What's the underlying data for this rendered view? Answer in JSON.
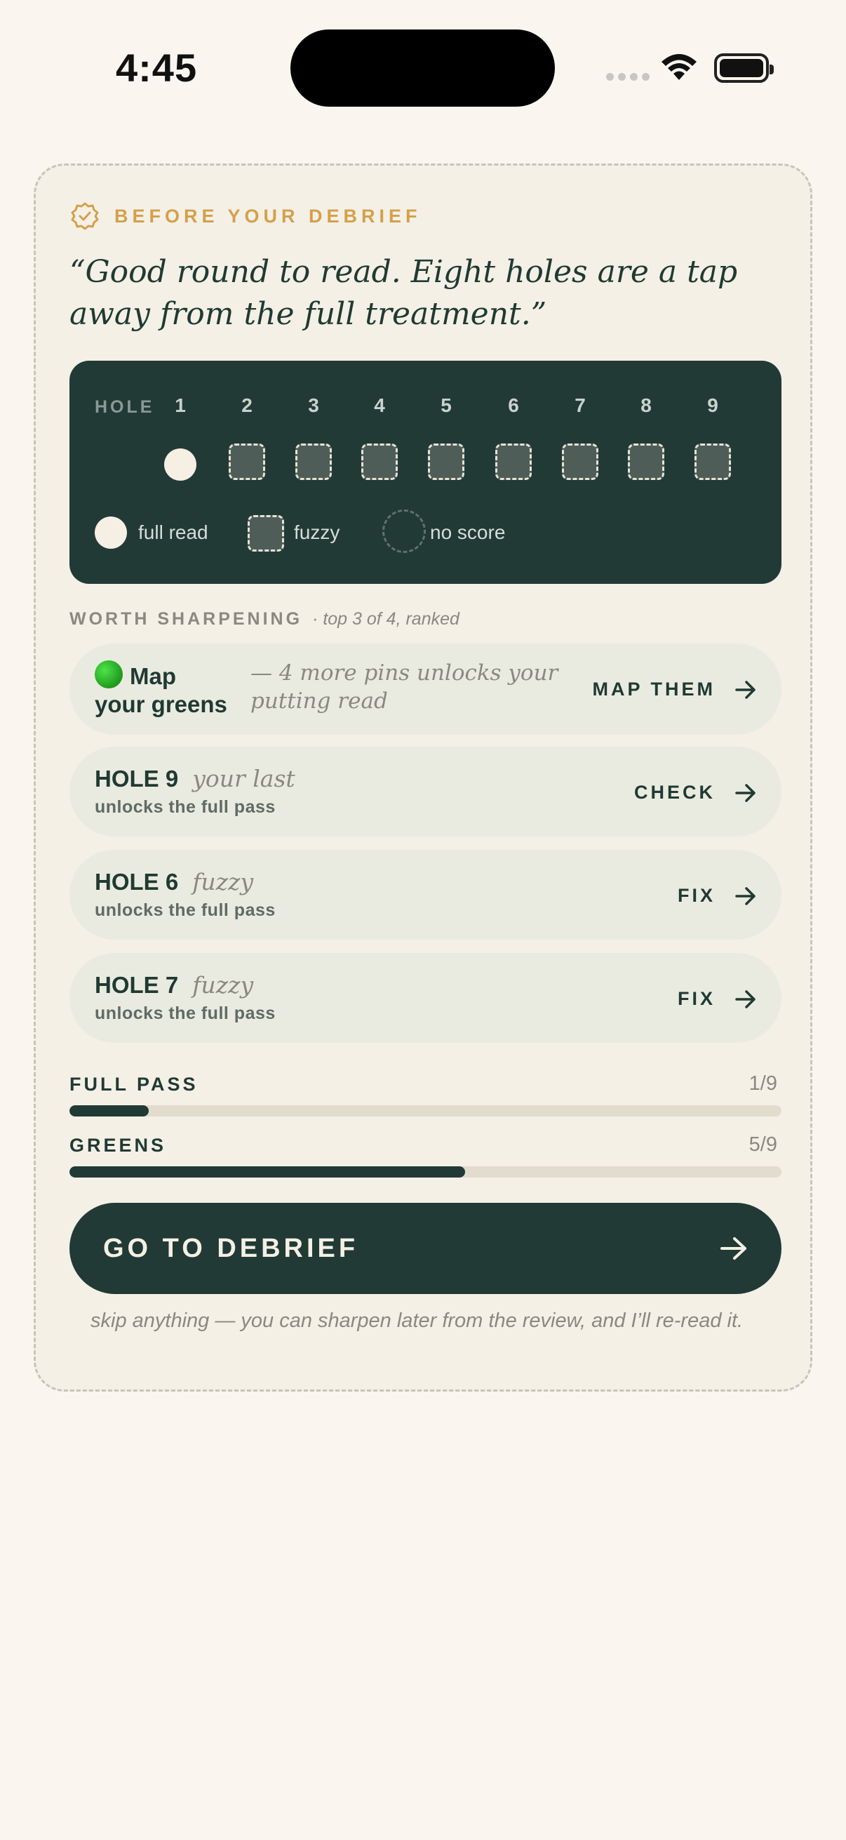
{
  "status_bar": {
    "time": "4:45"
  },
  "card": {
    "eyebrow": "BEFORE YOUR DEBRIEF",
    "quote": "“Good round to read. Eight holes are a tap away from the full treatment.”",
    "holes": {
      "label": "HOLE",
      "numbers": [
        "1",
        "2",
        "3",
        "4",
        "5",
        "6",
        "7",
        "8",
        "9"
      ],
      "states": [
        "full",
        "fuzzy",
        "fuzzy",
        "fuzzy",
        "fuzzy",
        "fuzzy",
        "fuzzy",
        "fuzzy",
        "fuzzy"
      ],
      "legend": {
        "full": "full read",
        "fuzzy": "fuzzy",
        "none": "no score"
      }
    },
    "sharpen": {
      "title": "WORTH SHARPENING",
      "subtitle": "· top 3 of 4, ranked",
      "map": {
        "title_line1": "Map",
        "title_line2": "your greens",
        "description": "— 4 more pins unlocks your putting read",
        "action": "MAP THEM"
      },
      "items": [
        {
          "title": "HOLE 9",
          "tag": "your last",
          "sub": "unlocks the full pass",
          "action": "CHECK"
        },
        {
          "title": "HOLE 6",
          "tag": "fuzzy",
          "sub": "unlocks the full pass",
          "action": "FIX"
        },
        {
          "title": "HOLE 7",
          "tag": "fuzzy",
          "sub": "unlocks the full pass",
          "action": "FIX"
        }
      ]
    },
    "progress": {
      "full_pass": {
        "label": "FULL PASS",
        "value": "1/9",
        "fraction": 0.111
      },
      "greens": {
        "label": "GREENS",
        "value": "5/9",
        "fraction": 0.556
      }
    },
    "cta": {
      "label": "GO TO DEBRIEF"
    },
    "footnote": "skip anything — you can sharpen later from the review, and I’ll re-read it."
  },
  "colors": {
    "accent": "#d4a04b",
    "dark": "#213a35",
    "background": "#faf6ef",
    "card": "#f4f0e6"
  }
}
